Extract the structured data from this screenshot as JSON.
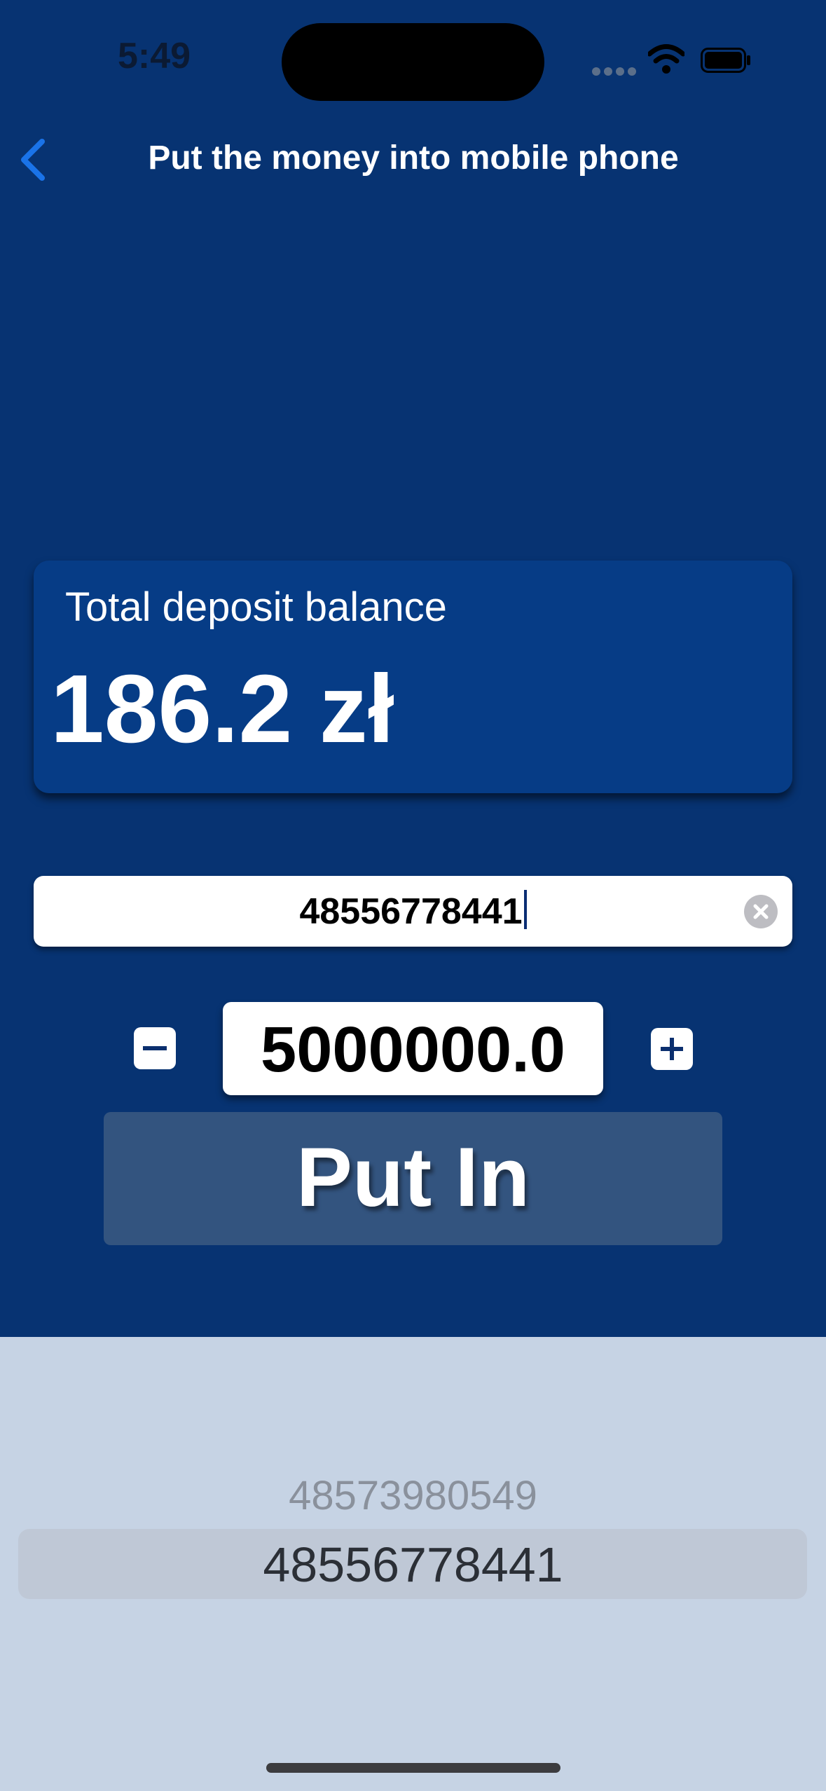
{
  "status_bar": {
    "time": "5:49"
  },
  "nav": {
    "title": "Put the money into mobile phone"
  },
  "balance": {
    "label": "Total deposit balance",
    "amount": "186.2 zł"
  },
  "phone_field": {
    "value": "48556778441"
  },
  "stepper": {
    "value": "5000000.0"
  },
  "put_button": {
    "label": "Put In"
  },
  "picker": {
    "options": [
      "48573980549",
      "48556778441"
    ],
    "selected": "48556778441"
  },
  "colors": {
    "background": "#073372",
    "card": "#063c86",
    "button": "#33547f",
    "picker": "#c6d3e4",
    "accent": "#1a73e8"
  }
}
